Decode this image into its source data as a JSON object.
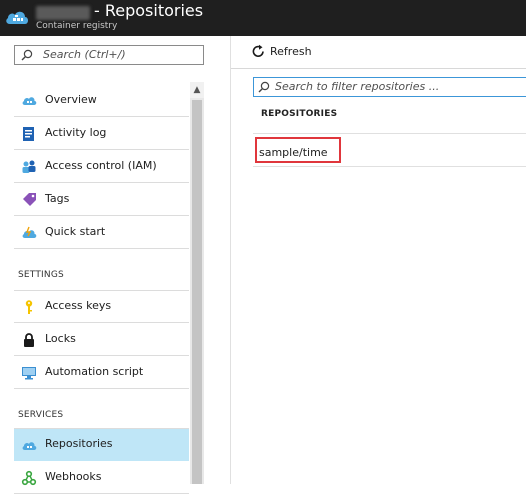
{
  "header": {
    "title": "- Repositories",
    "subtitle": "Container registry"
  },
  "sidebar": {
    "search_placeholder": "Search (Ctrl+/)",
    "items": [
      {
        "label": "Overview",
        "icon": "cloud-overview-icon"
      },
      {
        "label": "Activity log",
        "icon": "activity-log-icon"
      },
      {
        "label": "Access control (IAM)",
        "icon": "users-icon"
      },
      {
        "label": "Tags",
        "icon": "tag-icon"
      },
      {
        "label": "Quick start",
        "icon": "cloud-quickstart-icon"
      }
    ],
    "settings_label": "SETTINGS",
    "settings_items": [
      {
        "label": "Access keys",
        "icon": "key-icon"
      },
      {
        "label": "Locks",
        "icon": "lock-icon"
      },
      {
        "label": "Automation script",
        "icon": "monitor-icon"
      }
    ],
    "services_label": "SERVICES",
    "services_items": [
      {
        "label": "Repositories",
        "icon": "cloud-repo-icon",
        "selected": true
      },
      {
        "label": "Webhooks",
        "icon": "webhook-icon"
      }
    ]
  },
  "main": {
    "refresh_label": "Refresh",
    "filter_placeholder": "Search to filter repositories ...",
    "column_header": "REPOSITORIES",
    "repositories": [
      "sample/time"
    ]
  },
  "colors": {
    "header_bg": "#1f1f1f",
    "selected_bg": "#bfe6f7",
    "highlight_border": "#e0363c",
    "focus_border": "#3c96d8"
  }
}
